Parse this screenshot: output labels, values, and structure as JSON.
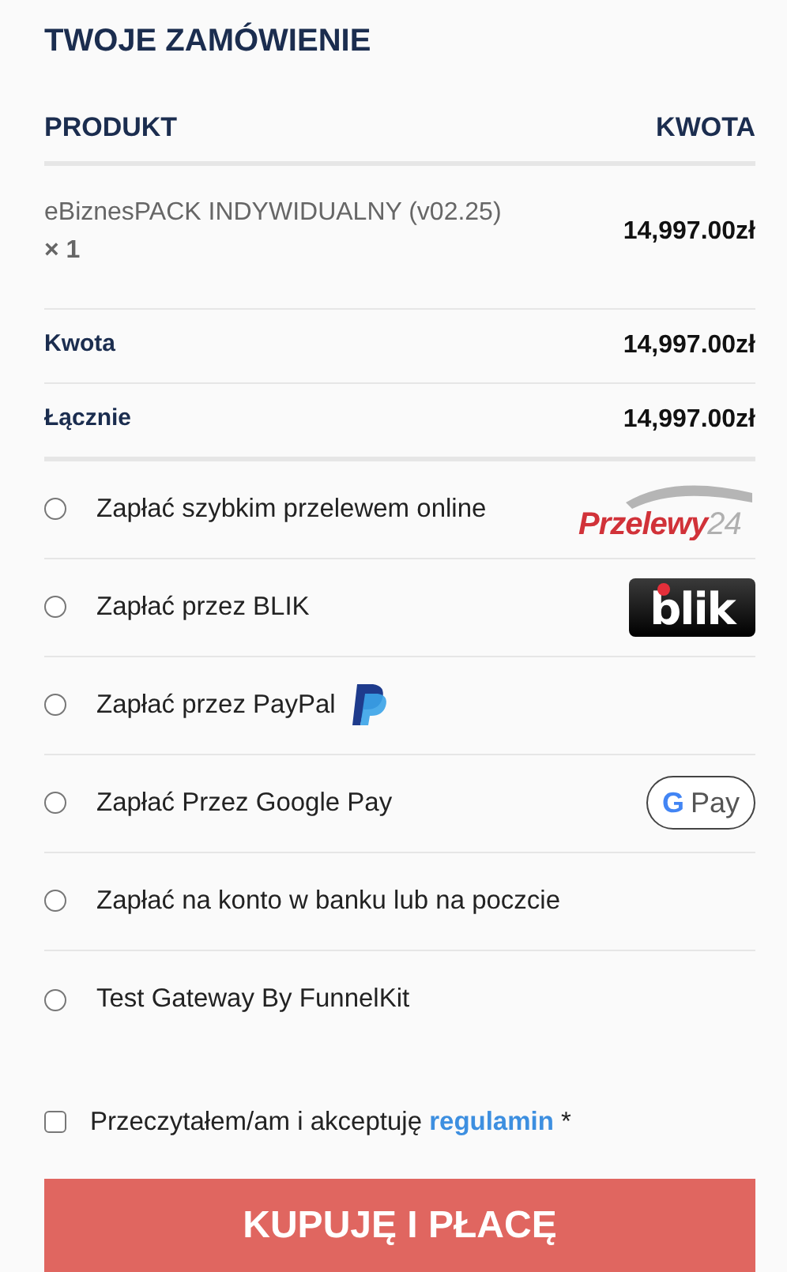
{
  "title": "TWOJE ZAMÓWIENIE",
  "table": {
    "columns": [
      "PRODUKT",
      "KWOTA"
    ],
    "items": [
      {
        "name": "eBiznesPACK INDYWIDUALNY (v02.25)",
        "quantity": "× 1",
        "amount": "14,997.00zł"
      }
    ],
    "totals": [
      {
        "label": "Kwota",
        "amount": "14,997.00zł"
      },
      {
        "label": "Łącznie",
        "amount": "14,997.00zł"
      }
    ]
  },
  "payment_methods": [
    {
      "label": "Zapłać szybkim przelewem online",
      "selected": false,
      "kind": "p24",
      "logo_text": [
        "Przelewy",
        "24"
      ]
    },
    {
      "label": "Zapłać przez BLIK",
      "selected": false,
      "kind": "blik",
      "logo_text": [
        "blik"
      ]
    },
    {
      "label": "Zapłać przez PayPal",
      "selected": false,
      "kind": "paypal"
    },
    {
      "label": "Zapłać Przez Google Pay",
      "selected": false,
      "kind": "gpay",
      "logo_text": [
        "G",
        "Pay"
      ]
    },
    {
      "label": "Zapłać na konto w banku lub na poczcie",
      "selected": false
    },
    {
      "label": "Test Gateway By FunnelKit",
      "selected": false
    }
  ],
  "terms": {
    "text": "Przeczytałem/am i akceptuję",
    "link": "regulamin",
    "required_mark": "*",
    "checked": false
  },
  "submit_button": "KUPUJĘ I PŁACĘ"
}
